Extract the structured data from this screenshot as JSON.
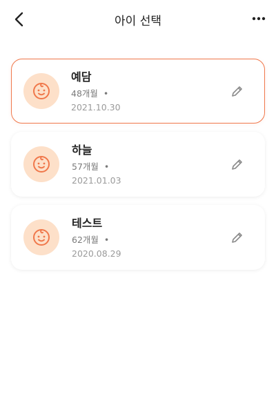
{
  "header": {
    "title": "아이 선택",
    "back_icon": "chevron-left-icon",
    "more_icon": "more-horizontal-icon"
  },
  "colors": {
    "accent": "#f0774a",
    "avatar_bg": "#fde0c9"
  },
  "children": [
    {
      "name": "예담",
      "age": "48개월",
      "separator": "•",
      "date": "2021.10.30",
      "selected": true
    },
    {
      "name": "하늘",
      "age": "57개월",
      "separator": "•",
      "date": "2021.01.03",
      "selected": false
    },
    {
      "name": "테스트",
      "age": "62개월",
      "separator": "•",
      "date": "2020.08.29",
      "selected": false
    }
  ]
}
